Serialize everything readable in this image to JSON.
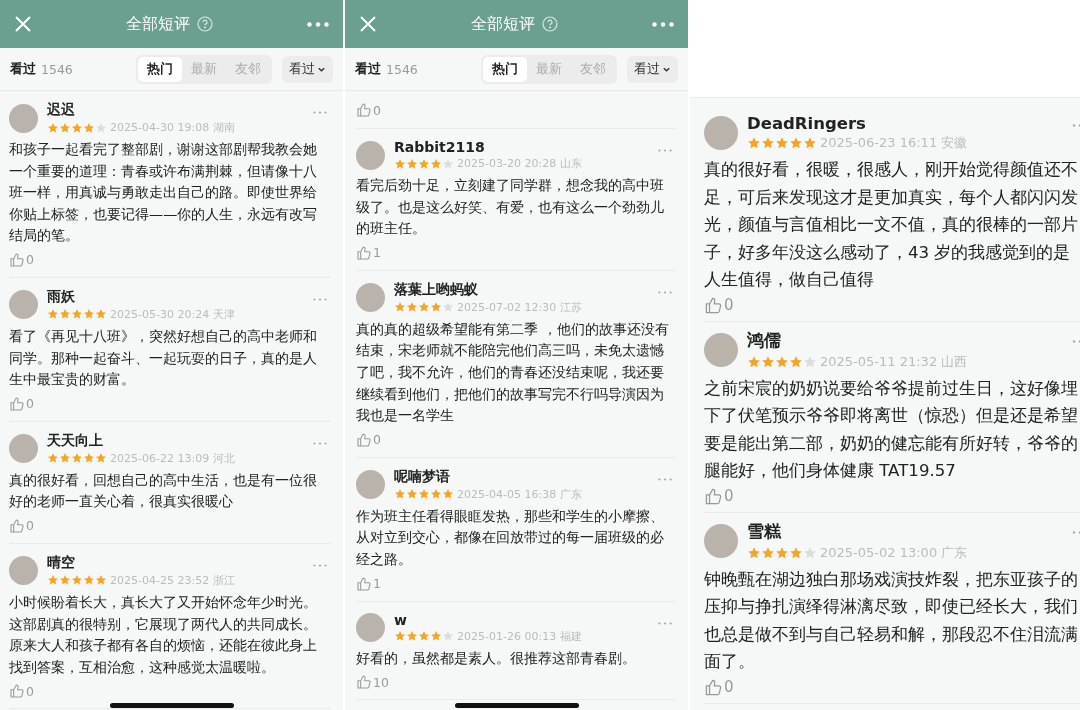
{
  "panels": [
    {
      "header": {
        "title": "全部短评"
      },
      "filter": {
        "label": "看过",
        "count": "1546",
        "tabs": [
          {
            "label": "热门",
            "selected": true
          },
          {
            "label": "最新",
            "selected": false
          },
          {
            "label": "友邻",
            "selected": false
          }
        ],
        "dropdown": "看过"
      },
      "home_indicator": true,
      "reviews": [
        {
          "user": "迟迟",
          "stars": 4,
          "meta": "2025-04-30 19:08 湖南",
          "text": "和孩子一起看完了整部剧，谢谢这部剧帮我教会她一个重要的道理：青春或许布满荆棘，但请像十八班一样，用真诚与勇敢走出自己的路。即使世界给你贴上标签，也要记得——你的人生，永远有改写结局的笔。",
          "likes": "0"
        },
        {
          "user": "雨妖",
          "stars": 5,
          "meta": "2025-05-30 20:24 天津",
          "text": "看了《再见十八班》，突然好想自己的高中老师和同学。那种一起奋斗、一起玩耍的日子，真的是人生中最宝贵的财富。",
          "likes": "0"
        },
        {
          "user": "天天向上",
          "stars": 5,
          "meta": "2025-06-22 13:09 河北",
          "text": "真的很好看，回想自己的高中生活，也是有一位很好的老师一直关心着，很真实很暖心",
          "likes": "0"
        },
        {
          "user": "晴空",
          "stars": 5,
          "meta": "2025-04-25 23:52 浙江",
          "text": "小时候盼着长大，真长大了又开始怀念年少时光。这部剧真的很特别，它展现了两代人的共同成长。原来大人和孩子都有各自的烦恼，还能在彼此身上找到答案，互相治愈，这种感觉太温暖啦。",
          "likes": "0"
        }
      ]
    },
    {
      "header": {
        "title": "全部短评"
      },
      "filter": {
        "label": "看过",
        "count": "1546",
        "tabs": [
          {
            "label": "热门",
            "selected": true
          },
          {
            "label": "最新",
            "selected": false
          },
          {
            "label": "友邻",
            "selected": false
          }
        ],
        "dropdown": "看过"
      },
      "home_indicator": true,
      "partial_likes": "0",
      "reviews": [
        {
          "user": "Rabbit2118",
          "stars": 4,
          "meta": "2025-03-20 20:28 山东",
          "text": "看完后劲十足，立刻建了同学群，想念我的高中班级了。也是这么好笑、有爱，也有这么一个劲劲儿的班主任。",
          "likes": "1"
        },
        {
          "user": "落葉上哟蚂蚁",
          "stars": 4,
          "meta": "2025-07-02 12:30 江苏",
          "text": "真的真的超级希望能有第二季 ，他们的故事还没有结束，宋老师就不能陪完他们高三吗，未免太遗憾了吧，我不允许，他们的青春还没结束呢，我还要继续看到他们，把他们的故事写完不行吗导演因为我也是一名学生",
          "likes": "0"
        },
        {
          "user": "呢喃梦语",
          "stars": 5,
          "meta": "2025-04-05 16:38 广东",
          "text": "作为班主任看得眼眶发热，那些和学生的小摩擦、从对立到交心，都像在回放带过的每一届班级的必经之路。",
          "likes": "1"
        },
        {
          "user": "w",
          "stars": 4,
          "meta": "2025-01-26 00:13 福建",
          "text": "好看的，虽然都是素人。很推荐这部青春剧。",
          "likes": "10"
        }
      ]
    },
    {
      "home_indicator": false,
      "reviews": [
        {
          "user": "DeadRingers",
          "stars": 5,
          "meta": "2025-06-23 16:11 安徽",
          "text": "真的很好看，很暖，很感人，刚开始觉得颜值还不足，可后来发现这才是更加真实，每个人都闪闪发光，颜值与言值相比一文不值，真的很棒的一部片子，好多年没这么感动了，43 岁的我感觉到的是人生值得，做自己值得",
          "likes": "0"
        },
        {
          "user": "鸿儒",
          "stars": 4,
          "meta": "2025-05-11 21:32 山西",
          "text": "之前宋宸的奶奶说要给爷爷提前过生日，这好像埋下了伏笔预示爷爷即将离世（惊恐）但是还是希望要是能出第二部，奶奶的健忘能有所好转，爷爷的腿能好，他们身体健康 TAT19.57",
          "likes": "0"
        },
        {
          "user": "雪糕",
          "stars": 4,
          "meta": "2025-05-02 13:00 广东",
          "text": "钟晚甄在湖边独白那场戏演技炸裂，把东亚孩子的压抑与挣扎演绎得淋漓尽致，即使已经长大，我们也总是做不到与自己轻易和解，那段忍不住泪流满面了。",
          "likes": "0"
        }
      ]
    }
  ]
}
